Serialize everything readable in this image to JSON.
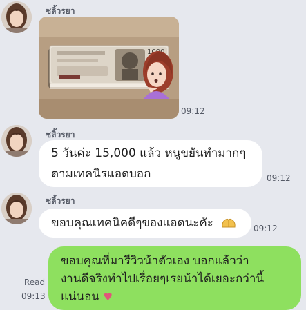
{
  "colors": {
    "chat_bg": "#e6e8ee",
    "bubble_in": "#ffffff",
    "bubble_out": "#8ee05f",
    "meta_text": "#555a66"
  },
  "messages": [
    {
      "sender": "ซลิ้วรยา",
      "type": "image",
      "image_desc": "banknote-stack-image",
      "time": "09:12"
    },
    {
      "sender": "ซลิ้วรยา",
      "type": "text",
      "lines": [
        "5 วันค่ะ 15,000 แล้ว หนูขยันทำมากๆ",
        "ตามเทคนิรแอดบอก"
      ],
      "time": "09:12"
    },
    {
      "sender": "ซลิ้วรยา",
      "type": "text",
      "lines": [
        "ขอบคุณเทคนิคดีๆของแอดนะคัะ"
      ],
      "emoji": "hands-emoji",
      "time": "09:12"
    },
    {
      "sender": "",
      "type": "text",
      "outgoing": true,
      "lines": [
        "ขอบคุณที่มารีวิวน้าตัวเอง บอกแล้วว่า",
        "งานดีจริงทำไปเรื่อยๆเรยน้าได้เยอะกว่านี้",
        "แน่นอน"
      ],
      "emoji": "heart-icon",
      "read": "Read",
      "time": "09:13"
    }
  ],
  "banknote_text": "1000"
}
